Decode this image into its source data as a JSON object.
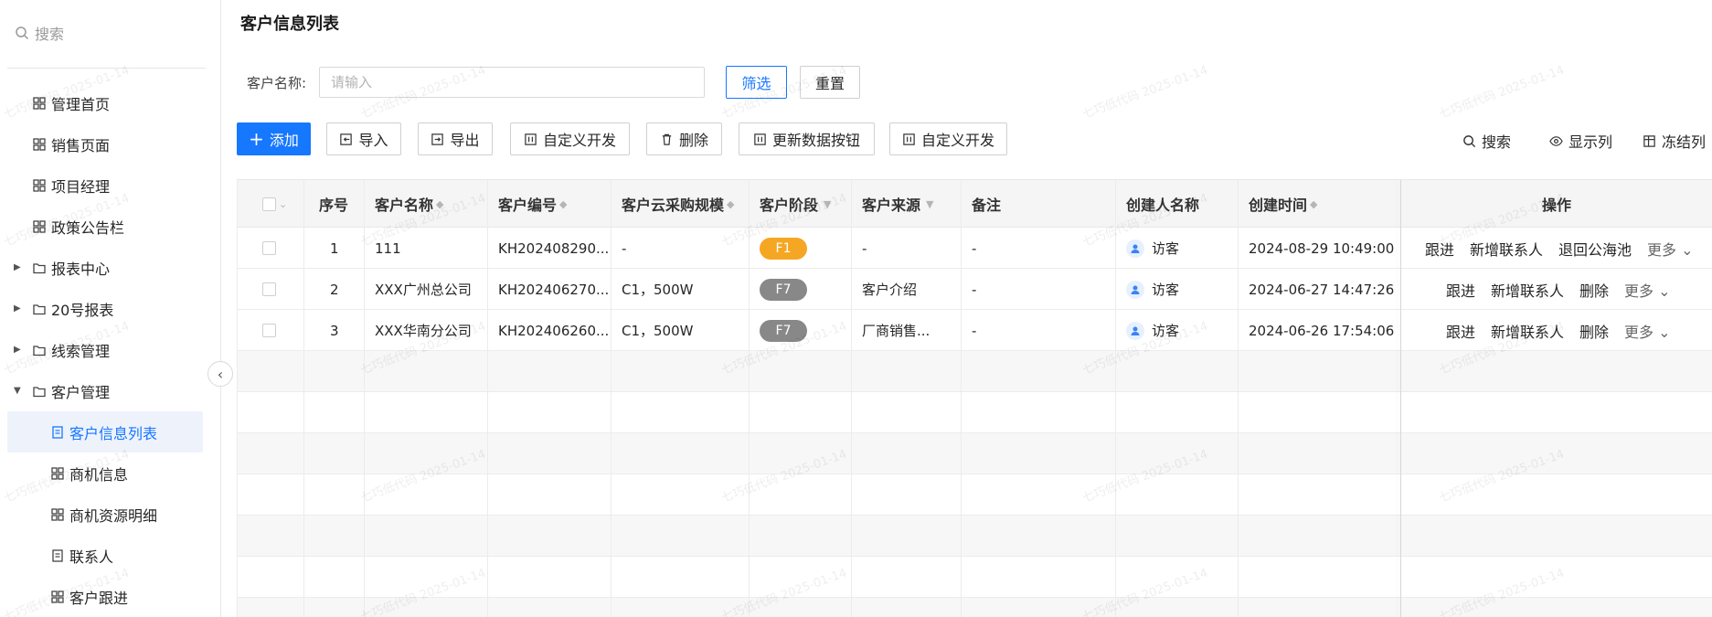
{
  "sidebar": {
    "search_placeholder": "搜索",
    "items": [
      {
        "label": "管理首页",
        "icon": "grid-icon"
      },
      {
        "label": "销售页面",
        "icon": "grid-icon"
      },
      {
        "label": "项目经理",
        "icon": "grid-icon"
      },
      {
        "label": "政策公告栏",
        "icon": "grid-icon"
      },
      {
        "label": "报表中心",
        "icon": "folder-icon",
        "expanded": false
      },
      {
        "label": "20号报表",
        "icon": "folder-icon",
        "expanded": false
      },
      {
        "label": "线索管理",
        "icon": "folder-icon",
        "expanded": false
      },
      {
        "label": "客户管理",
        "icon": "folder-icon",
        "expanded": true
      },
      {
        "label": "客户信息列表",
        "icon": "form-icon",
        "active": true
      },
      {
        "label": "商机信息",
        "icon": "grid-icon"
      },
      {
        "label": "商机资源明细",
        "icon": "grid-icon"
      },
      {
        "label": "联系人",
        "icon": "form-icon"
      },
      {
        "label": "客户跟进",
        "icon": "grid-icon"
      }
    ]
  },
  "page": {
    "title": "客户信息列表",
    "filter_label": "客户名称:",
    "filter_placeholder": "请输入",
    "filter_button": "筛选",
    "reset_button": "重置"
  },
  "toolbar": {
    "add": "添加",
    "import": "导入",
    "export": "导出",
    "custom_dev": "自定义开发",
    "delete": "删除",
    "update_data": "更新数据按钮",
    "custom_dev_2": "自定义开发",
    "search": "搜索",
    "show_columns": "显示列",
    "freeze_columns": "冻结列"
  },
  "table": {
    "headers": {
      "index": "序号",
      "name": "客户名称",
      "code": "客户编号",
      "scale": "客户云采购规模",
      "stage": "客户阶段",
      "source": "客户来源",
      "remark": "备注",
      "creator": "创建人名称",
      "created": "创建时间",
      "ops": "操作"
    },
    "rows": [
      {
        "index": "1",
        "name": "111",
        "code": "KH202408290...",
        "scale": "-",
        "stage": "F1",
        "source": "-",
        "remark": "-",
        "creator": "访客",
        "created": "2024-08-29 10:49:00",
        "ops": [
          "跟进",
          "新增联系人",
          "退回公海池"
        ],
        "more": "更多"
      },
      {
        "index": "2",
        "name": "XXX广州总公司",
        "code": "KH202406270...",
        "scale": "C1，500W",
        "stage": "F7",
        "source": "客户介绍",
        "remark": "-",
        "creator": "访客",
        "created": "2024-06-27 14:47:26",
        "ops": [
          "跟进",
          "新增联系人",
          "删除"
        ],
        "more": "更多"
      },
      {
        "index": "3",
        "name": "XXX华南分公司",
        "code": "KH202406260...",
        "scale": "C1，500W",
        "stage": "F7",
        "source": "厂商销售...",
        "remark": "-",
        "creator": "访客",
        "created": "2024-06-26 17:54:06",
        "ops": [
          "跟进",
          "新增联系人",
          "删除"
        ],
        "more": "更多"
      }
    ]
  },
  "watermark": "七巧低代码 2025-01-14",
  "colors": {
    "primary": "#1677ff",
    "stage_f1": "#f5a623",
    "stage_f7": "#888888",
    "active_bg": "#eef2fb"
  }
}
